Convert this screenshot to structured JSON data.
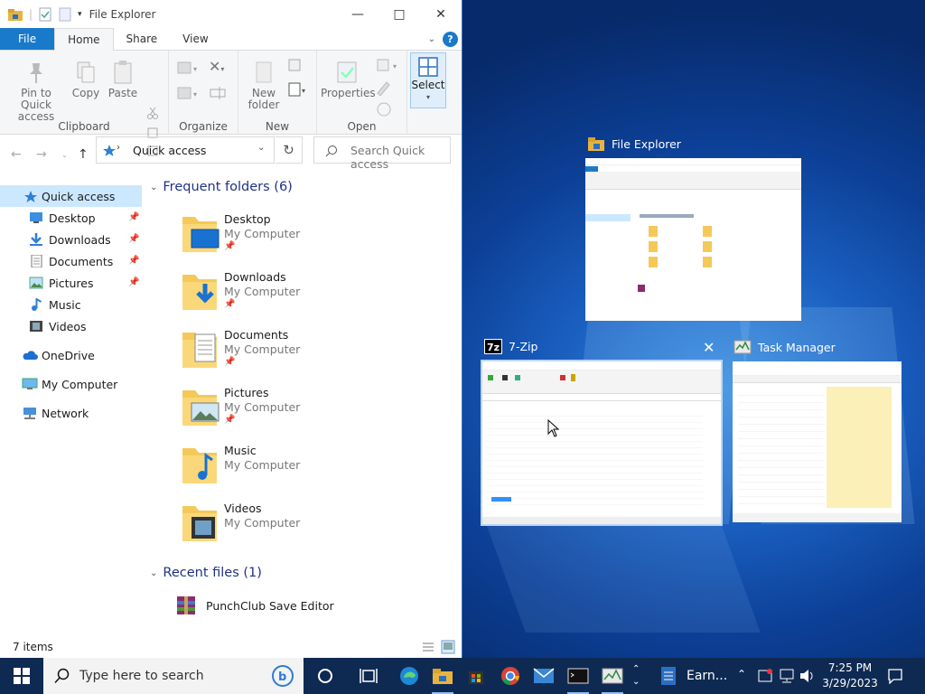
{
  "window": {
    "title": "File Explorer"
  },
  "menu_tabs": [
    {
      "label": "File"
    },
    {
      "label": "Home"
    },
    {
      "label": "Share"
    },
    {
      "label": "View"
    }
  ],
  "ribbon": {
    "clipboard": {
      "label": "Clipboard",
      "pin": "Pin to Quick access",
      "copy": "Copy",
      "paste": "Paste"
    },
    "organize": {
      "label": "Organize"
    },
    "new": {
      "label": "New",
      "new_folder": "New folder"
    },
    "open": {
      "label": "Open",
      "properties": "Properties"
    },
    "select": {
      "label": "Select"
    }
  },
  "address": {
    "path": "Quick access",
    "search_placeholder": "Search Quick access"
  },
  "nav": [
    {
      "label": "Quick access",
      "icon": "star-icon"
    },
    {
      "label": "Desktop",
      "icon": "desktop-icon",
      "pinned": true
    },
    {
      "label": "Downloads",
      "icon": "download-icon",
      "pinned": true
    },
    {
      "label": "Documents",
      "icon": "documents-icon",
      "pinned": true
    },
    {
      "label": "Pictures",
      "icon": "pictures-icon",
      "pinned": true
    },
    {
      "label": "Music",
      "icon": "music-icon"
    },
    {
      "label": "Videos",
      "icon": "videos-icon"
    },
    {
      "label": "OneDrive",
      "icon": "cloud-icon"
    },
    {
      "label": "My Computer",
      "icon": "computer-icon"
    },
    {
      "label": "Network",
      "icon": "network-icon"
    }
  ],
  "frequent": {
    "header": "Frequent folders (6)",
    "items": [
      {
        "name": "Desktop",
        "location": "My Computer"
      },
      {
        "name": "Downloads",
        "location": "My Computer"
      },
      {
        "name": "Documents",
        "location": "My Computer"
      },
      {
        "name": "Pictures",
        "location": "My Computer"
      },
      {
        "name": "Music",
        "location": "My Computer"
      },
      {
        "name": "Videos",
        "location": "My Computer"
      }
    ]
  },
  "recent": {
    "header": "Recent files (1)",
    "items": [
      {
        "name": "PunchClub Save Editor"
      }
    ]
  },
  "status": {
    "items": "7 items"
  },
  "task_view": {
    "windows": [
      {
        "title": "File Explorer"
      },
      {
        "title": "7-Zip"
      },
      {
        "title": "Task Manager"
      }
    ]
  },
  "taskbar": {
    "search_placeholder": "Type here to search",
    "app_label": "Earn...",
    "time": "7:25 PM",
    "date": "3/29/2023"
  },
  "colors": {
    "accent": "#1979ca",
    "selection": "#cce8ff",
    "header_blue": "#1e3287",
    "taskbar": "#0f2a52"
  }
}
